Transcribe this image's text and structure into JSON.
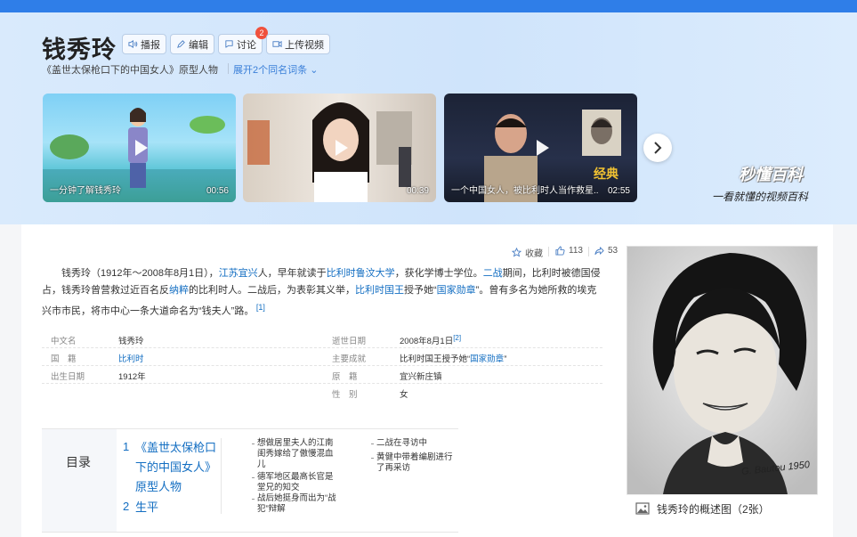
{
  "colors": {
    "accent": "#2f7ee8",
    "link": "#136ec2",
    "badge": "#f0513d"
  },
  "header": {
    "title": "钱秀玲",
    "buttons": [
      {
        "label": "播报",
        "icon": "speaker-icon"
      },
      {
        "label": "编辑",
        "icon": "pencil-icon"
      },
      {
        "label": "讨论",
        "icon": "chat-icon",
        "badge": "2"
      },
      {
        "label": "上传视频",
        "icon": "video-icon"
      }
    ],
    "subtitle": "《盖世太保枪口下的中国女人》原型人物",
    "expand_label": "展开2个同名词条"
  },
  "videos": [
    {
      "title": "一分钟了解钱秀玲",
      "duration": "00:56"
    },
    {
      "title": "",
      "duration": "00:39"
    },
    {
      "title": "一个中国女人，被比利时人当作救星...",
      "duration": "02:55"
    }
  ],
  "brand": {
    "name": "秒懂百科",
    "slogan": "一看就懂的视频百科"
  },
  "actions": {
    "favorite_label": "收藏",
    "likes": "113",
    "shares": "53"
  },
  "summary": {
    "segments": [
      {
        "t": "钱秀玲（1912年～2008年8月1日），"
      },
      {
        "t": "江苏宜兴",
        "link": true
      },
      {
        "t": "人，早年就读于"
      },
      {
        "t": "比利时鲁汶大学",
        "link": true
      },
      {
        "t": "，获化学博士学位。"
      },
      {
        "t": "二战",
        "link": true
      },
      {
        "t": "期间，比利时被德国侵占，钱秀玲曾营救过近百名反"
      },
      {
        "t": "纳粹",
        "link": true
      },
      {
        "t": "的比利时人。二战后，为表彰其义举，"
      },
      {
        "t": "比利时国王",
        "link": true
      },
      {
        "t": "授予她“"
      },
      {
        "t": "国家勋章",
        "link": true
      },
      {
        "t": "”。曾有多名为她所救的埃克兴市市民，将市中心一条大道命名为“钱夫人”路。"
      },
      {
        "t": " [1]",
        "sup": true
      }
    ]
  },
  "infobox": {
    "left": [
      {
        "label": "中文名",
        "value": "钱秀玲"
      },
      {
        "label": "国　籍",
        "value": "比利时",
        "link": true
      },
      {
        "label": "出生日期",
        "value": "1912年"
      }
    ],
    "right": [
      {
        "label": "逝世日期",
        "value": "2008年8月1日",
        "ref": "[2]"
      },
      {
        "label": "主要成就",
        "value": "比利时国王授予她“国家勋章”",
        "linkpart": "国家勋章"
      },
      {
        "label": "原　籍",
        "value": "宜兴新庄镇"
      },
      {
        "label": "性　别",
        "value": "女"
      }
    ]
  },
  "toc": {
    "title": "目录",
    "main": [
      {
        "num": "1",
        "label": "《盖世太保枪口下的中国女人》原型人物"
      },
      {
        "num": "2",
        "label": "生平"
      }
    ],
    "col2": [
      "想做居里夫人的江南闺秀嫁给了傲慢混血儿",
      "德军地区最高长官是堂兄的知交",
      "战后她挺身而出为“战犯”辩解"
    ],
    "col3": [
      "二战在寻访中",
      "黄健中带着编剧进行了再采访"
    ]
  },
  "photo": {
    "caption": "钱秀玲的概述图（2张）",
    "signature": "G. Bautou 1950"
  }
}
